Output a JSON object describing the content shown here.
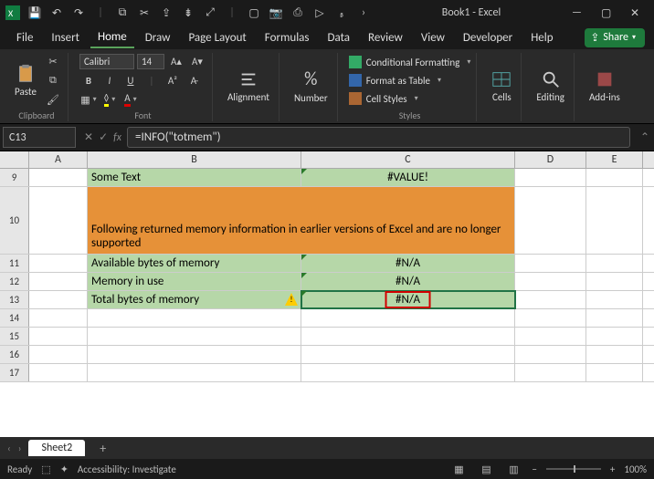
{
  "titlebar": {
    "document_title": "Book1 - Excel"
  },
  "menu_tabs": [
    "File",
    "Insert",
    "Home",
    "Draw",
    "Page Layout",
    "Formulas",
    "Data",
    "Review",
    "View",
    "Developer",
    "Help"
  ],
  "active_tab": "Home",
  "share_label": "Share",
  "ribbon": {
    "clipboard": {
      "paste": "Paste",
      "label": "Clipboard"
    },
    "font": {
      "family": "Calibri",
      "size": "14",
      "label": "Font",
      "bold": "B",
      "italic": "I",
      "underline": "U"
    },
    "alignment": {
      "label": "Alignment"
    },
    "number": {
      "big": "%",
      "label": "Number"
    },
    "styles": {
      "cond": "Conditional Formatting",
      "table": "Format as Table",
      "styles": "Cell Styles",
      "label": "Styles"
    },
    "cells": {
      "label": "Cells"
    },
    "editing": {
      "label": "Editing"
    },
    "addins": {
      "label": "Add-ins"
    }
  },
  "namebox": "C13",
  "formula_bar": "=INFO(\"totmem\")",
  "columns": [
    "A",
    "B",
    "C",
    "D",
    "E"
  ],
  "rows": {
    "r9": {
      "n": "9",
      "b": "Some Text",
      "c": "#VALUE!"
    },
    "r10": {
      "n": "10",
      "bc": "Following returned memory information in earlier versions of Excel and are no longer supported"
    },
    "r11": {
      "n": "11",
      "b": "Available bytes of memory",
      "c": "#N/A"
    },
    "r12": {
      "n": "12",
      "b": "Memory in use",
      "c": "#N/A"
    },
    "r13": {
      "n": "13",
      "b": "Total bytes of memory",
      "c": "#N/A"
    },
    "r14": {
      "n": "14"
    },
    "r15": {
      "n": "15"
    },
    "r16": {
      "n": "16"
    },
    "r17": {
      "n": "17"
    }
  },
  "sheet_tab": "Sheet2",
  "status": {
    "ready": "Ready",
    "accessibility": "Accessibility: Investigate",
    "zoom": "100%"
  }
}
